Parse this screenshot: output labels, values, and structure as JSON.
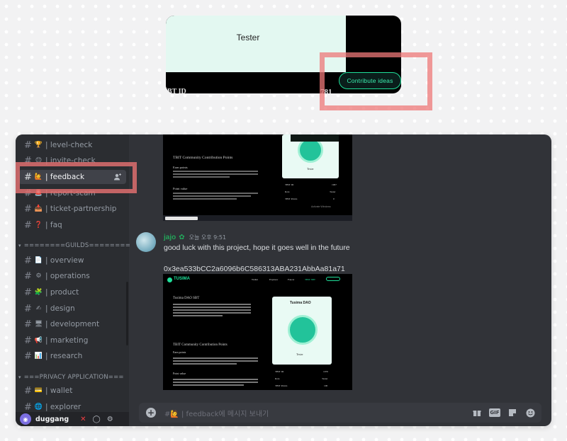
{
  "top_card": {
    "tester": "Tester",
    "contribute_label": "Contribute ideas",
    "tail_left": "BT ID",
    "tail_right": "781"
  },
  "sidebar": {
    "channels_top": [
      {
        "emoji": "🏆",
        "label": "| level-check"
      },
      {
        "emoji": "😊",
        "label": "| invite-check"
      },
      {
        "emoji": "🙋",
        "label": "| feedback"
      },
      {
        "emoji": "🚨",
        "label": "| report-scam"
      },
      {
        "emoji": "📥",
        "label": "| ticket-partnership"
      },
      {
        "emoji": "❓",
        "label": "| faq"
      }
    ],
    "category_guilds": "========GUILDS========",
    "channels_guilds": [
      {
        "emoji": "📄",
        "label": "| overview"
      },
      {
        "emoji": "⚙",
        "label": "| operations"
      },
      {
        "emoji": "🧩",
        "label": "| product"
      },
      {
        "emoji": "✍",
        "label": "| design"
      },
      {
        "emoji": "🖥",
        "label": "| development"
      },
      {
        "emoji": "📢",
        "label": "| marketing"
      },
      {
        "emoji": "📊",
        "label": "| research"
      }
    ],
    "category_privacy": "===PRIVACY APPLICATION===",
    "channels_privacy": [
      {
        "emoji": "💳",
        "label": "| wallet"
      },
      {
        "emoji": "🌐",
        "label": "| explorer"
      }
    ],
    "user": {
      "name": "duggang"
    }
  },
  "chat": {
    "shot1": {
      "heading": "TBIT Community Contribution Points",
      "sub1": "Earn points",
      "sub2": "Point value",
      "card_label": "Tester",
      "rows": [
        [
          "TBIT ID",
          "1967"
        ],
        [
          "Role",
          "Tester"
        ],
        [
          "TBIT Points",
          "0"
        ]
      ],
      "activate": "Activate Windows"
    },
    "message": {
      "username": "jajo",
      "time": "오늘 오후 9:51",
      "text": "good luck with this project, hope it goes well in the future",
      "address": "0x3ea533bCC2a6096b6C586313ABA231AbbAa81a71"
    },
    "shot2": {
      "brand": "TUSIMA",
      "nav": [
        "Wallet",
        "Explorer",
        "Faucet",
        "TBIT SBT"
      ],
      "title": "Tusima DAO SBT",
      "card_title": "Tusima DAO",
      "card_label": "Tester",
      "heading": "TBIT Community Contribution Points",
      "sub1": "Earn points",
      "sub2": "Point value",
      "rows": [
        [
          "TBIT ID",
          "1970"
        ],
        [
          "Role",
          "Tester"
        ],
        [
          "TBIT Points",
          "100"
        ]
      ]
    },
    "composer_placeholder": "#🙋 | feedback에 메시지 보내기"
  }
}
